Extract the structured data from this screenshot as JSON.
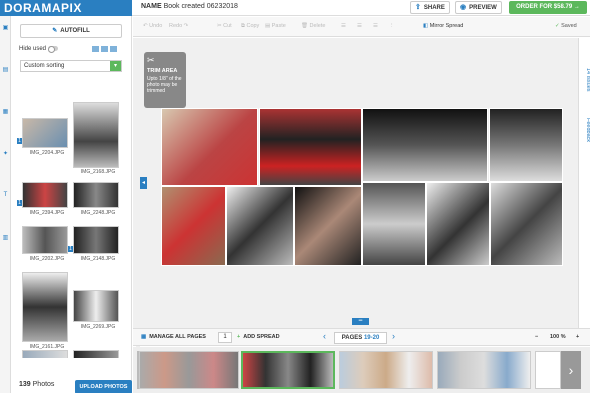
{
  "header": {
    "logo": "DORAMAPIX",
    "name_label": "NAME",
    "book_name": "Book created 06232018",
    "share_label": "SHARE",
    "preview_label": "PREVIEW",
    "order_label": "ORDER FOR $58.79"
  },
  "toolbar": {
    "undo": "Undo",
    "redo": "Redo",
    "cut": "Cut",
    "copy": "Copy",
    "paste": "Paste",
    "delete": "Delete",
    "mirror_spread": "Mirror Spread",
    "saved": "Saved"
  },
  "leftpanel": {
    "autofill_label": "AUTOFILL",
    "hide_used_label": "Hide used",
    "sort_value": "Custom sorting",
    "photo_count": "139",
    "photo_word": "Photos",
    "upload_label": "UPLOAD PHOTOS",
    "thumbs": [
      {
        "label": "IMG_2204.JPG",
        "badge": "1"
      },
      {
        "label": "IMG_2168.JPG",
        "badge": ""
      },
      {
        "label": "IMG_2394.JPG",
        "badge": "1"
      },
      {
        "label": "IMG_2248.JPG",
        "badge": ""
      },
      {
        "label": "IMG_2202.JPG",
        "badge": ""
      },
      {
        "label": "IMG_2148.JPG",
        "badge": "1"
      },
      {
        "label": "IMG_2161.JPG",
        "badge": ""
      },
      {
        "label": "IMG_2269.JPG",
        "badge": ""
      }
    ]
  },
  "trim": {
    "title": "TRIM AREA",
    "text": "Upto 1/8\" of the photo may be trimmed"
  },
  "right_tabs": {
    "issues": "14 Issues",
    "feedback": "Feedback"
  },
  "bottombar": {
    "manage_label": "MANAGE ALL PAGES",
    "page_value": "1",
    "add_spread_label": "ADD SPREAD",
    "pages_label": "PAGES",
    "pages_range": "19-20",
    "zoom_minus": "−",
    "zoom_value": "100 %",
    "zoom_plus": "+"
  },
  "colors": {
    "accent": "#2a7fc1",
    "order_green": "#5cb85c"
  }
}
